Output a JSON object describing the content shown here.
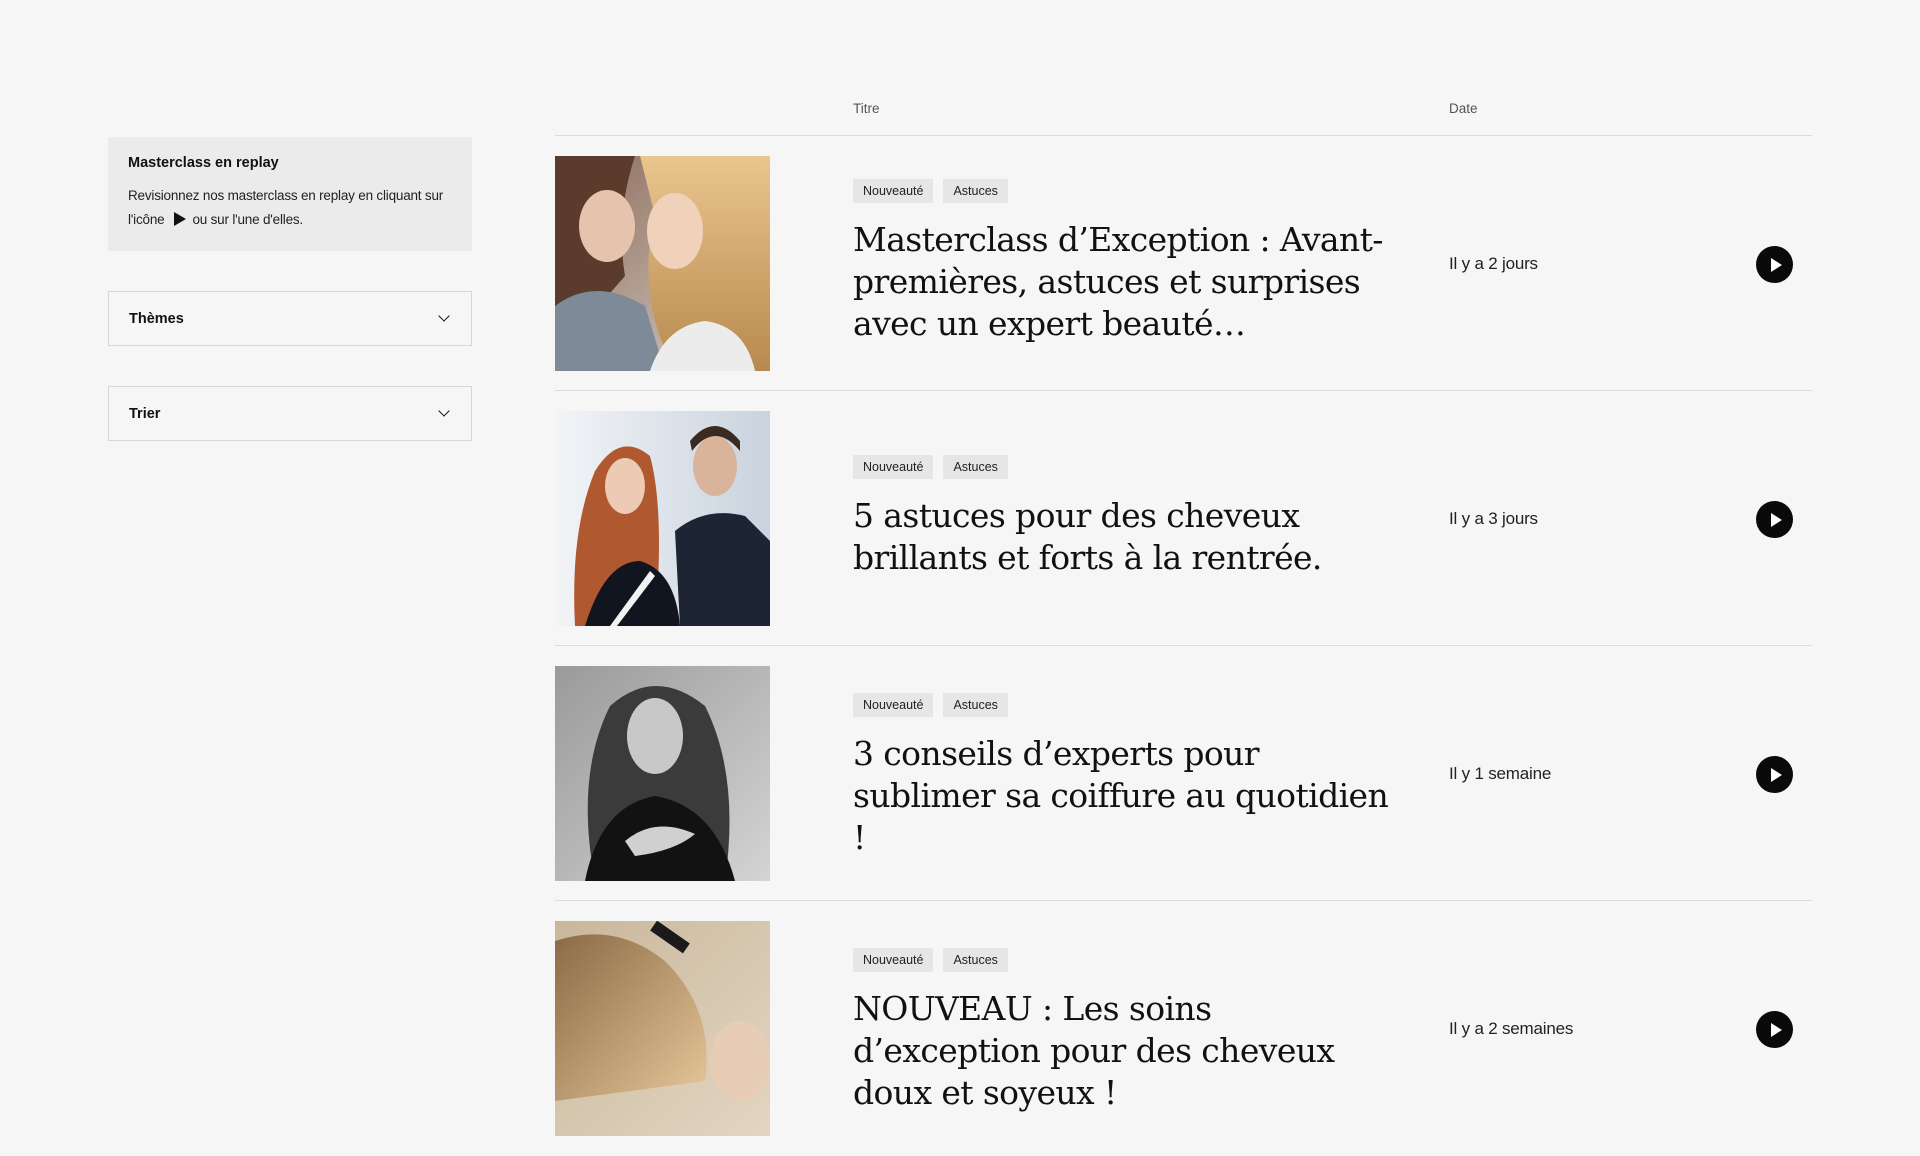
{
  "sidebar": {
    "info": {
      "title": "Masterclass en replay",
      "text_before_icon": "Revisionnez nos masterclass en replay en cliquant sur l'icône",
      "text_after_icon": "ou sur l'une d'elles."
    },
    "dropdowns": [
      {
        "label": "Thèmes"
      },
      {
        "label": "Trier"
      }
    ]
  },
  "table": {
    "headers": {
      "title": "Titre",
      "date": "Date"
    },
    "rows": [
      {
        "tags": [
          "Nouveauté",
          "Astuces"
        ],
        "title": "Masterclass d’Exception : Avant-premières, astuces et surprises avec un expert beauté…",
        "date": "Il y a 2 jours"
      },
      {
        "tags": [
          "Nouveauté",
          "Astuces"
        ],
        "title": "5 astuces pour des cheveux brillants et forts à la rentrée.",
        "date": "Il y a 3 jours"
      },
      {
        "tags": [
          "Nouveauté",
          "Astuces"
        ],
        "title": "3 conseils d’experts pour sublimer sa coiffure au quotidien !",
        "date": "Il y 1 semaine"
      },
      {
        "tags": [
          "Nouveauté",
          "Astuces"
        ],
        "title": "NOUVEAU : Les soins d’exception pour des cheveux doux et soyeux !",
        "date": "Il y a 2 semaines"
      }
    ]
  },
  "colors": {
    "background": "#f6f6f6",
    "accent": "#0a0a0a",
    "tag_bg": "#e6e6e6"
  }
}
